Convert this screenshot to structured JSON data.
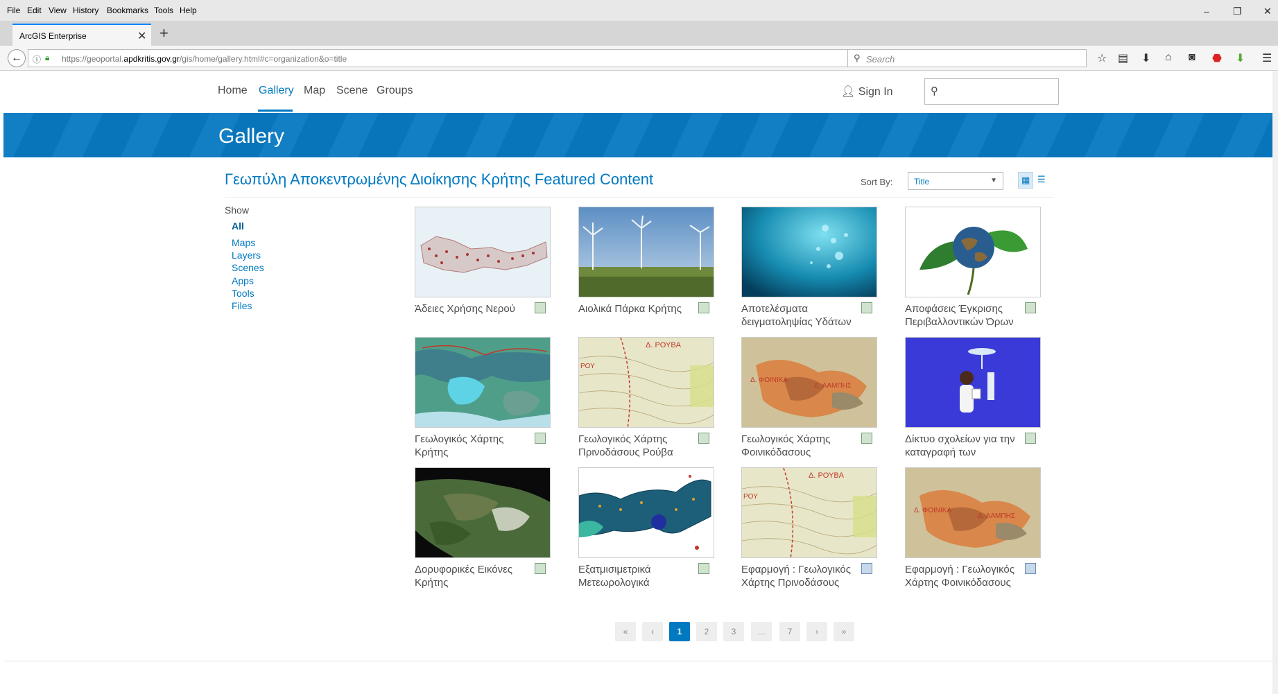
{
  "browser": {
    "menu": [
      "File",
      "Edit",
      "View",
      "History",
      "Bookmarks",
      "Tools",
      "Help"
    ],
    "window_controls": {
      "minimize": "–",
      "restore": "❐",
      "close": "✕"
    },
    "tab": {
      "title": "ArcGIS Enterprise",
      "close": "✕",
      "new_tab": "+"
    },
    "url": {
      "prefix": "https://geoportal.",
      "domain": "apdkritis.gov.gr",
      "path": "/gis/home/gallery.html#c=organization&o=title"
    },
    "search_placeholder": "Search",
    "toolbar_icons": [
      "star-icon",
      "reading-list-icon",
      "download-icon",
      "home-icon",
      "pocket-icon",
      "adblock-icon",
      "extension-icon",
      "menu-icon"
    ]
  },
  "site": {
    "nav": [
      "Home",
      "Gallery",
      "Map",
      "Scene",
      "Groups"
    ],
    "active_nav": "Gallery",
    "sign_in": "Sign In",
    "banner_title": "Gallery",
    "accent": "#0079c1"
  },
  "gallery": {
    "heading": "Γεωπύλη Αποκεντρωμένης Διοίκησης Κρήτης Featured Content",
    "sort_label": "Sort By:",
    "sort_value": "Title",
    "filter": {
      "title": "Show",
      "items": [
        "All",
        "Maps",
        "Layers",
        "Scenes",
        "Apps",
        "Tools",
        "Files"
      ],
      "active": "All"
    },
    "items": [
      {
        "title": "Άδειες Χρήσης Νερού",
        "type": "map"
      },
      {
        "title": "Αιολικά Πάρκα Κρήτης",
        "type": "map"
      },
      {
        "title": "Αποτελέσματα δειγματοληψίας Υδάτων",
        "type": "map"
      },
      {
        "title": "Αποφάσεις Έγκρισης Περιβαλλοντικών Όρων",
        "type": "map"
      },
      {
        "title": "Γεωλογικός Χάρτης Κρήτης",
        "type": "map"
      },
      {
        "title": "Γεωλογικός Χάρτης Πρινοδάσους Ρούβα",
        "type": "map"
      },
      {
        "title": "Γεωλογικός Χάρτης Φοινικόδασους",
        "type": "map"
      },
      {
        "title": "Δίκτυο σχολείων για την καταγραφή των",
        "type": "map"
      },
      {
        "title": "Δορυφορικές Εικόνες Κρήτης",
        "type": "map"
      },
      {
        "title": "Εξατμισιμετρικά Μετεωρολογικά",
        "type": "map"
      },
      {
        "title": "Εφαρμογή : Γεωλογικός Χάρτης Πρινοδάσους",
        "type": "app"
      },
      {
        "title": "Εφαρμογή : Γεωλογικός Χάρτης Φοινικόδασους",
        "type": "app"
      }
    ],
    "thumb_labels": {
      "rouva": "Δ. ΡΟΥΒΑ",
      "rou": "ΡΟΥ",
      "foinika": "Δ. ΦΟΙΝΙΚΑ",
      "lampis": "Δ. ΛΑΜΠΗΣ"
    }
  },
  "pagination": {
    "first": "«",
    "prev": "‹",
    "pages": [
      "1",
      "2",
      "3",
      "…",
      "7"
    ],
    "current": "1",
    "next": "›",
    "last": "»"
  }
}
